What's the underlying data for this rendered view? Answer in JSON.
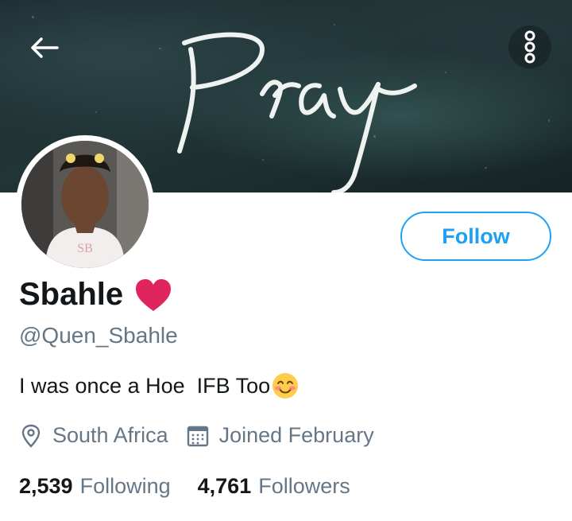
{
  "header": {
    "banner_text": "Pray",
    "back_icon": "arrow-left-icon",
    "more_icon": "more-vertical-icon"
  },
  "profile": {
    "name": "Sbahle",
    "name_emoji": "red-heart-icon",
    "handle": "@Quen_Sbahle",
    "bio": "I was once a Hoe  IFB Too",
    "bio_emoji": "smiling-face-icon",
    "location": "South Africa",
    "joined": "Joined February"
  },
  "actions": {
    "follow_label": "Follow"
  },
  "stats": {
    "following_count": "2,539",
    "following_label": "Following",
    "followers_count": "4,761",
    "followers_label": "Followers"
  },
  "colors": {
    "accent": "#1da1f2",
    "text_primary": "#14171a",
    "text_secondary": "#657786",
    "heart": "#e0245e"
  }
}
